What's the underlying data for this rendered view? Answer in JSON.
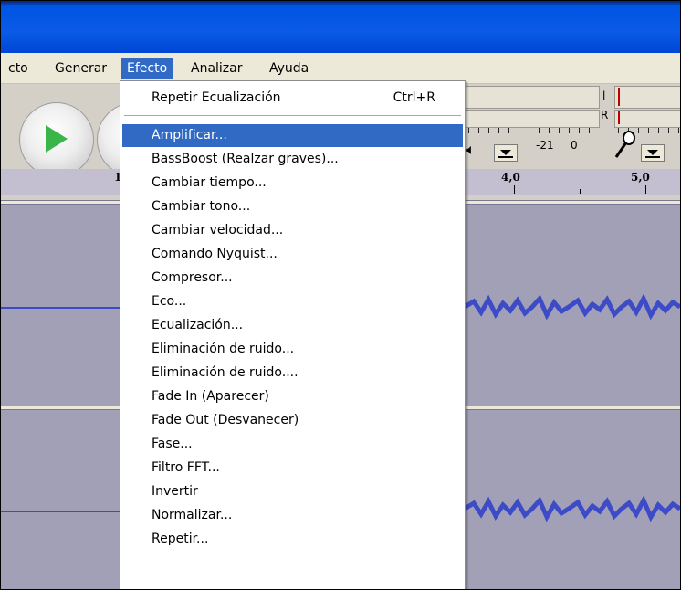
{
  "menubar": {
    "items": [
      {
        "label": "cto",
        "active": false
      },
      {
        "label": "Generar",
        "active": false
      },
      {
        "label": "Efecto",
        "active": true
      },
      {
        "label": "Analizar",
        "active": false
      },
      {
        "label": "Ayuda",
        "active": false
      }
    ]
  },
  "toolbar": {
    "meter_letters": {
      "l": "l",
      "r": "R"
    },
    "level_labels": {
      "minus21": "-21",
      "zero": "0"
    },
    "icons": {
      "play": "play-icon",
      "speaker": "speaker-icon",
      "microphone": "microphone-icon"
    }
  },
  "ruler": {
    "labels": {
      "one": "1",
      "four": "4,0",
      "five": "5,0"
    }
  },
  "effect_menu": {
    "repeat_item": {
      "label": "Repetir Ecualización",
      "shortcut": "Ctrl+R"
    },
    "items": [
      "Amplificar...",
      "BassBoost (Realzar graves)...",
      "Cambiar tiempo...",
      "Cambiar tono...",
      "Cambiar velocidad...",
      "Comando Nyquist...",
      "Compresor...",
      "Eco...",
      "Ecualización...",
      "Eliminación de ruido...",
      "Eliminación de ruido....",
      "Fade In (Aparecer)",
      "Fade Out (Desvanecer)",
      "Fase...",
      "Filtro FFT...",
      "Invertir",
      "Normalizar...",
      "Repetir..."
    ],
    "highlighted_index": 0
  },
  "colors": {
    "title_bar": "#0054e3",
    "menu_highlight": "#316ac5",
    "track_background": "#a2a0b6",
    "waveform": "#3d4bc7",
    "play_green": "#39b54a"
  }
}
